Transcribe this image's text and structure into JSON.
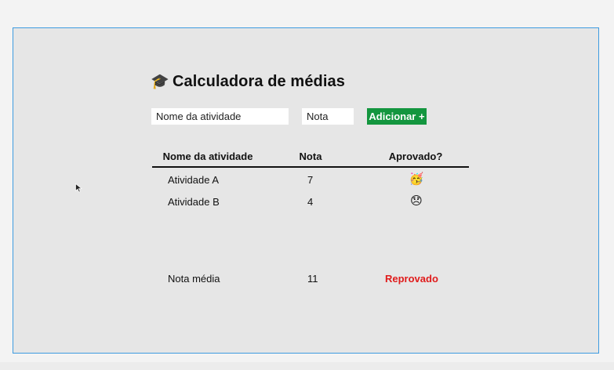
{
  "app": {
    "title_icon": "🎓",
    "title": "Calculadora de médias"
  },
  "form": {
    "name_placeholder": "Nome da atividade",
    "grade_placeholder": "Nota",
    "add_label": "Adicionar +"
  },
  "table": {
    "headers": [
      "Nome da atividade",
      "Nota",
      "Aprovado?"
    ],
    "rows": [
      {
        "name": "Atividade A",
        "grade": "7",
        "status_emoji": "🥳",
        "status_icon": "party-face-icon"
      },
      {
        "name": "Atividade B",
        "grade": "4",
        "status_emoji": "😞",
        "status_icon": "sad-face-icon"
      }
    ],
    "footer": {
      "label": "Nota média",
      "value": "11",
      "status": "Reprovado",
      "status_color": "#e01b1b"
    }
  },
  "colors": {
    "accent": "#14963f",
    "frame_border": "#3d9be0",
    "background": "#e6e6e6"
  }
}
